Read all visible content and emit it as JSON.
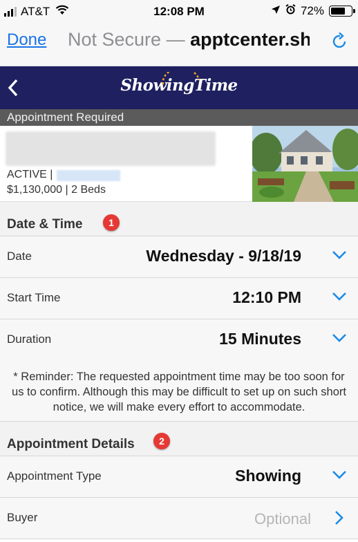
{
  "status_bar": {
    "carrier": "AT&T",
    "time": "12:08 PM",
    "battery": "72%",
    "battery_level": 0.72
  },
  "browser": {
    "done_label": "Done",
    "not_secure": "Not Secure —",
    "domain": "apptcenter.sho",
    "reload_icon": "reload-icon"
  },
  "app": {
    "logo_text": "ShowingTime",
    "back_icon": "chevron-left-icon",
    "header_bg": "#1f2060"
  },
  "banner": {
    "text": "Appointment Required"
  },
  "listing": {
    "status": "ACTIVE |",
    "price_beds": "$1,130,000 | 2 Beds"
  },
  "date_time": {
    "title": "Date & Time",
    "badge": "1",
    "rows": [
      {
        "label": "Date",
        "value": "Wednesday - 9/18/19"
      },
      {
        "label": "Start Time",
        "value": "12:10 PM"
      },
      {
        "label": "Duration",
        "value": "15 Minutes"
      }
    ],
    "reminder": "* Reminder: The requested appointment time may be too soon for us to confirm. Although this may be difficult to set up on such short notice, we will make every effort to accommodate."
  },
  "appointment_details": {
    "title": "Appointment Details",
    "badge": "2",
    "rows": [
      {
        "label": "Appointment Type",
        "value": "Showing"
      },
      {
        "label": "Buyer",
        "placeholder": "Optional"
      }
    ]
  },
  "colors": {
    "accent": "#1a8ae8",
    "badge": "#e53935"
  }
}
